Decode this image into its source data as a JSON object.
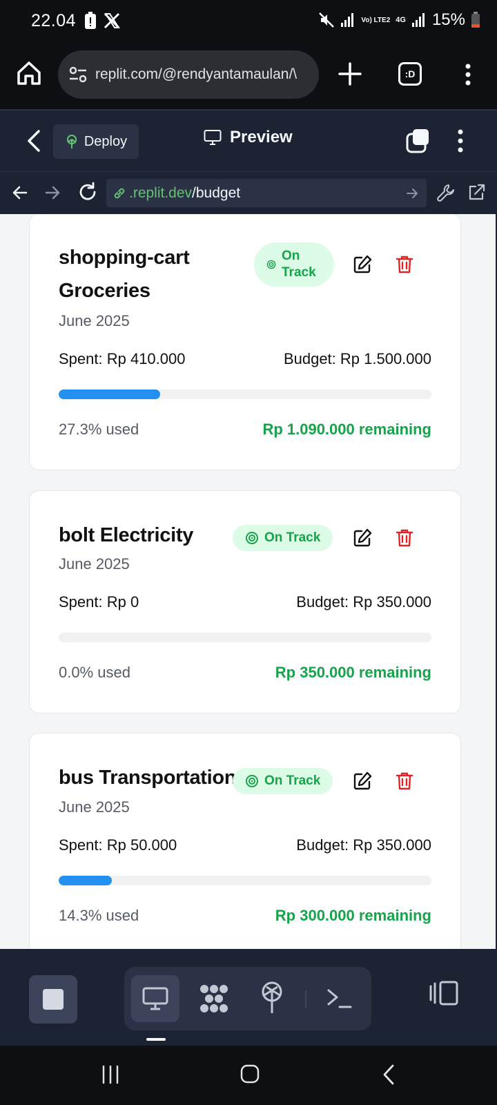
{
  "status_bar": {
    "time": "22.04",
    "battery_percent": "15%",
    "signal_label": "Vo) LTE2",
    "network_label": "4G"
  },
  "browser": {
    "url": "replit.com/@rendyantamaulan/\\",
    "tabs_label": ":D"
  },
  "replit_header": {
    "deploy_label": "Deploy",
    "preview_label": "Preview"
  },
  "webview": {
    "url_host": ".replit.dev",
    "url_path": "/budget"
  },
  "budgets": [
    {
      "icon_word": "shopping-cart",
      "category": "Groceries",
      "title": "shopping-cart Groceries",
      "period": "June 2025",
      "status": "On Track",
      "spent": "Spent: Rp 410.000",
      "budget": "Budget: Rp 1.500.000",
      "progress_fraction": 0.273,
      "used": "27.3% used",
      "remaining": "Rp 1.090.000 remaining"
    },
    {
      "icon_word": "bolt",
      "category": "Electricity",
      "title": "bolt Electricity",
      "period": "June 2025",
      "status": "On Track",
      "spent": "Spent: Rp 0",
      "budget": "Budget: Rp 350.000",
      "progress_fraction": 0.0,
      "used": "0.0% used",
      "remaining": "Rp 350.000 remaining"
    },
    {
      "icon_word": "bus",
      "category": "Transportation",
      "title": "bus Transportation",
      "period": "June 2025",
      "status": "On Track",
      "spent": "Spent: Rp 50.000",
      "budget": "Budget: Rp 350.000",
      "progress_fraction": 0.143,
      "used": "14.3% used",
      "remaining": "Rp 300.000 remaining"
    }
  ],
  "colors": {
    "on_track_text": "#16a34a",
    "on_track_bg": "#dcfce7",
    "progress_fill": "#2290ee",
    "delete_red": "#dc2626",
    "replit_bg": "#1c2333"
  }
}
